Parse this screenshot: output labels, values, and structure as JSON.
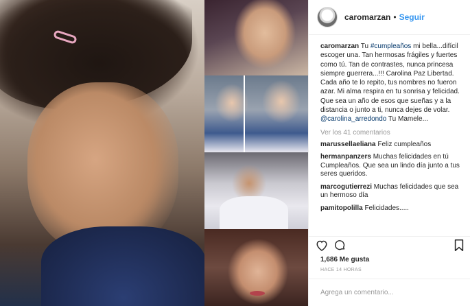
{
  "header": {
    "username": "caromarzan",
    "separator": "•",
    "follow_label": "Seguir"
  },
  "caption": {
    "username": "caromarzan",
    "text_1": " Tu ",
    "hashtag": "#cumpleaños",
    "text_2": " mi bella...difícil escoger una. Tan hermosas frágiles y fuertes como tú. Tan de contrastes, nunca princesa siempre guerrera...!!! Carolina Paz Libertad. Cada año te lo repito, tus nombres no fueron azar. Mi alma respira en tu sonrisa y felicidad. Que sea un año de esos que sueñas y a la distancia o junto a ti, nunca dejes de volar. ",
    "mention": "@carolina_arredondo",
    "text_3": " Tu Mamele..."
  },
  "view_all_comments": "Ver los 41 comentarios",
  "comments": [
    {
      "username": "marussellaeliana",
      "text": " Feliz cumpleaños"
    },
    {
      "username": "hermanpanzers",
      "text": " Muchas felicidades en tú Cumpleaños. Que sea un lindo día junto a tus seres queridos."
    },
    {
      "username": "marcogutierrezi",
      "text": " Muchas felicidades que sea un hermoso día"
    },
    {
      "username": "pamitopolilla",
      "text": " Felicidades....."
    }
  ],
  "actions": {
    "like_icon": "heart-icon",
    "comment_icon": "speech-bubble-icon",
    "save_icon": "bookmark-icon"
  },
  "likes": "1,686 Me gusta",
  "timestamp": "HACE 14 HORAS",
  "add_comment": {
    "placeholder": "Agrega un comentario..."
  },
  "colors": {
    "link_blue": "#3897f0",
    "link_dark": "#003569",
    "muted": "#999999",
    "text": "#262626",
    "border": "#efefef"
  }
}
